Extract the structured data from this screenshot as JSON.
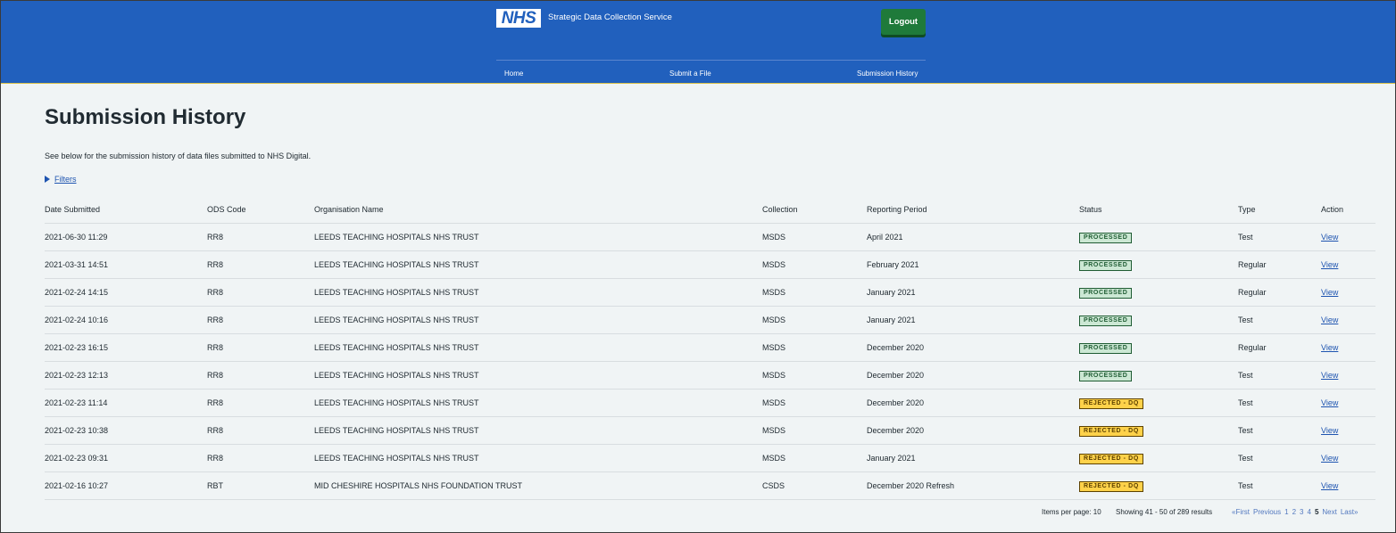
{
  "header": {
    "logo_text": "NHS",
    "service_name": "Strategic Data Collection Service",
    "logout_label": "Logout",
    "nav": [
      {
        "label": "Home"
      },
      {
        "label": "Submit a File"
      },
      {
        "label": "Submission History"
      }
    ]
  },
  "main": {
    "title": "Submission History",
    "intro": "See below for the submission history of data files submitted to NHS Digital.",
    "filters_label": "Filters"
  },
  "table": {
    "columns": [
      "Date Submitted",
      "ODS Code",
      "Organisation Name",
      "Collection",
      "Reporting Period",
      "Status",
      "Type",
      "Action"
    ],
    "rows": [
      {
        "date": "2021-06-30 11:29",
        "ods": "RR8",
        "org": "LEEDS TEACHING HOSPITALS NHS TRUST",
        "collection": "MSDS",
        "period": "April 2021",
        "status": "PROCESSED",
        "type": "Test",
        "action": "View"
      },
      {
        "date": "2021-03-31 14:51",
        "ods": "RR8",
        "org": "LEEDS TEACHING HOSPITALS NHS TRUST",
        "collection": "MSDS",
        "period": "February 2021",
        "status": "PROCESSED",
        "type": "Regular",
        "action": "View"
      },
      {
        "date": "2021-02-24 14:15",
        "ods": "RR8",
        "org": "LEEDS TEACHING HOSPITALS NHS TRUST",
        "collection": "MSDS",
        "period": "January 2021",
        "status": "PROCESSED",
        "type": "Regular",
        "action": "View"
      },
      {
        "date": "2021-02-24 10:16",
        "ods": "RR8",
        "org": "LEEDS TEACHING HOSPITALS NHS TRUST",
        "collection": "MSDS",
        "period": "January 2021",
        "status": "PROCESSED",
        "type": "Test",
        "action": "View"
      },
      {
        "date": "2021-02-23 16:15",
        "ods": "RR8",
        "org": "LEEDS TEACHING HOSPITALS NHS TRUST",
        "collection": "MSDS",
        "period": "December 2020",
        "status": "PROCESSED",
        "type": "Regular",
        "action": "View"
      },
      {
        "date": "2021-02-23 12:13",
        "ods": "RR8",
        "org": "LEEDS TEACHING HOSPITALS NHS TRUST",
        "collection": "MSDS",
        "period": "December 2020",
        "status": "PROCESSED",
        "type": "Test",
        "action": "View"
      },
      {
        "date": "2021-02-23 11:14",
        "ods": "RR8",
        "org": "LEEDS TEACHING HOSPITALS NHS TRUST",
        "collection": "MSDS",
        "period": "December 2020",
        "status": "REJECTED - DQ",
        "type": "Test",
        "action": "View"
      },
      {
        "date": "2021-02-23 10:38",
        "ods": "RR8",
        "org": "LEEDS TEACHING HOSPITALS NHS TRUST",
        "collection": "MSDS",
        "period": "December 2020",
        "status": "REJECTED - DQ",
        "type": "Test",
        "action": "View"
      },
      {
        "date": "2021-02-23 09:31",
        "ods": "RR8",
        "org": "LEEDS TEACHING HOSPITALS NHS TRUST",
        "collection": "MSDS",
        "period": "January 2021",
        "status": "REJECTED - DQ",
        "type": "Test",
        "action": "View"
      },
      {
        "date": "2021-02-16 10:27",
        "ods": "RBT",
        "org": "MID CHESHIRE HOSPITALS NHS FOUNDATION TRUST",
        "collection": "CSDS",
        "period": "December 2020 Refresh",
        "status": "REJECTED - DQ",
        "type": "Test",
        "action": "View"
      }
    ]
  },
  "pagination": {
    "items_per_page": "Items per page: 10",
    "showing": "Showing 41 - 50 of 289 results",
    "first": "«First",
    "previous": "Previous",
    "pages": [
      "1",
      "2",
      "3",
      "4",
      "5"
    ],
    "current_page": "5",
    "next": "Next",
    "last": "Last»"
  },
  "colors": {
    "header_bg": "#2160bd",
    "logout_bg": "#1f7a3a",
    "processed_bg": "#cce8d4",
    "rejected_bg": "#ffd24a",
    "link": "#1e54b0"
  }
}
